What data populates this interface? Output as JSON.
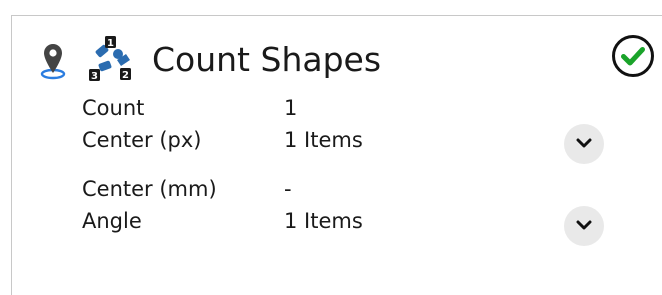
{
  "panel": {
    "title": "Count Shapes",
    "pin_icon": "map-pin-icon",
    "tool_icon": "count-shapes-icon",
    "tool_icon_badges": [
      "1",
      "2",
      "3"
    ],
    "status_icon": "checkmark-circle-icon",
    "status_color": "#1aa32a",
    "accent_color": "#2b6cb0"
  },
  "rows": [
    {
      "label": "Count",
      "value": "1"
    },
    {
      "label": "Center (px)",
      "value": "1 Items",
      "expand_icon": "chevron-down-icon"
    },
    {
      "label": "Center (mm)",
      "value": "-"
    },
    {
      "label": "Angle",
      "value": "1 Items",
      "expand_icon": "chevron-down-icon"
    }
  ]
}
